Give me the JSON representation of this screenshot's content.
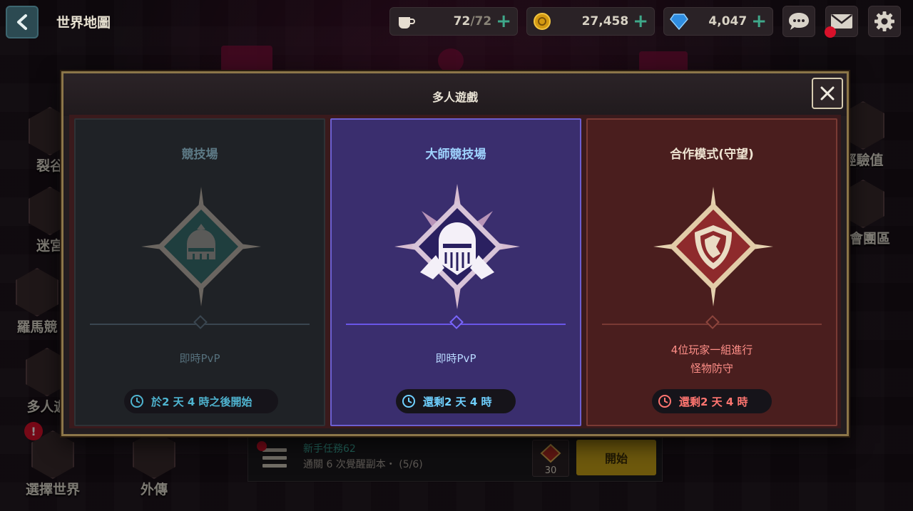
{
  "header": {
    "back_label": "back",
    "title": "世界地圖"
  },
  "resources": {
    "stamina": {
      "current": "72",
      "max": "/72",
      "icon": "coffee-cup-icon"
    },
    "gold": {
      "value": "27,458",
      "icon": "gold-coin-icon"
    },
    "gems": {
      "value": "4,047",
      "icon": "gem-icon"
    },
    "plus": "+"
  },
  "side_menu": {
    "left": [
      {
        "label": "裂谷"
      },
      {
        "label": "迷宮"
      },
      {
        "label": "羅馬競"
      },
      {
        "label": "多人遊"
      },
      {
        "label": "選擇世界"
      },
      {
        "label": "外傳"
      }
    ],
    "right": [
      {
        "label": "經驗值"
      },
      {
        "label": "公會團區"
      }
    ]
  },
  "quest": {
    "title": "新手任務62",
    "description": "通關 6 次覺醒副本・ (5/6)",
    "reward_count": "30",
    "start_label": "開始"
  },
  "modal": {
    "title": "多人遊戲",
    "close_label": "×",
    "cards": {
      "arena": {
        "title": "競技場",
        "description": "即時PvP",
        "timer": "於2 天 4 時之後開始",
        "state": "locked"
      },
      "master_arena": {
        "title": "大師競技場",
        "description": "即時PvP",
        "timer": "還剩2 天 4 時",
        "state": "selected"
      },
      "coop": {
        "title": "合作模式(守望)",
        "description_line1": "4位玩家一組進行",
        "description_line2": "怪物防守",
        "timer": "還剩2 天 4 時",
        "state": "active"
      }
    }
  },
  "colors": {
    "gold_frame": "#8c7649",
    "arena_accent": "#4fb4d0",
    "master_accent": "#6d5fd1",
    "coop_accent": "#ff7570",
    "notification": "#d8112a"
  }
}
